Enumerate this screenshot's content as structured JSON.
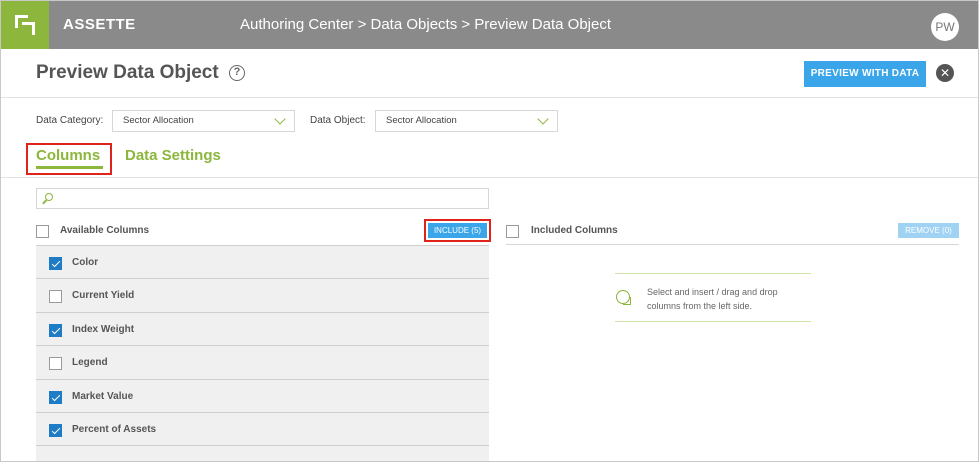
{
  "topbar": {
    "brand": "ASSETTE",
    "breadcrumb": "Authoring Center > Data Objects > Preview Data Object",
    "avatar_initials": "PW"
  },
  "header": {
    "title": "Preview Data Object",
    "help_glyph": "?",
    "preview_button": "PREVIEW WITH DATA",
    "close_glyph": "✕"
  },
  "filters": {
    "category_label": "Data Category:",
    "category_value": "Sector Allocation",
    "object_label": "Data Object:",
    "object_value": "Sector Allocation"
  },
  "tabs": [
    {
      "label": "Columns",
      "active": true
    },
    {
      "label": "Data Settings",
      "active": false
    }
  ],
  "search": {
    "placeholder": ""
  },
  "available": {
    "title": "Available Columns",
    "include_button": "INCLUDE (5)",
    "rows": [
      {
        "label": "Color",
        "checked": true
      },
      {
        "label": "Current Yield",
        "checked": false
      },
      {
        "label": "Index Weight",
        "checked": true
      },
      {
        "label": "Legend",
        "checked": false
      },
      {
        "label": "Market Value",
        "checked": true
      },
      {
        "label": "Percent of Assets",
        "checked": true
      }
    ]
  },
  "included": {
    "title": "Included Columns",
    "remove_button": "REMOVE (0)",
    "empty_message": "Select and insert / drag and drop columns from the left side."
  },
  "colors": {
    "brand_green": "#8cb63c",
    "accent_blue": "#3aa6e9",
    "checkbox_blue": "#1e7cc6",
    "highlight_red": "#e0231a",
    "topbar_gray": "#8a8a8a"
  }
}
